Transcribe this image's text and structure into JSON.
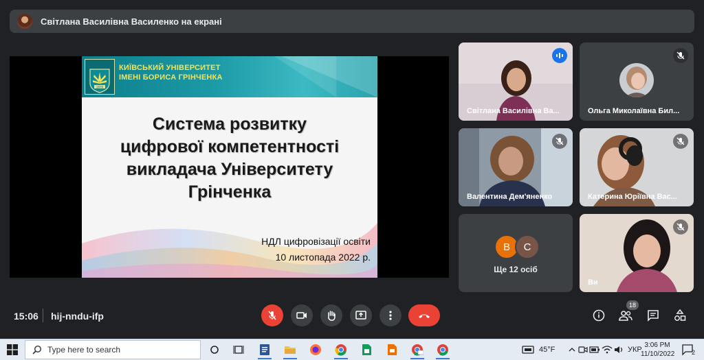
{
  "banner": {
    "presenter_text": "Світлана Василівна Василенко на екрані"
  },
  "slide": {
    "university_line1": "Київський університет",
    "university_line2": "імені Бориса Грінченка",
    "logo_year": "1876",
    "title_lines": [
      "Система розвитку",
      "цифрової компетентності",
      "викладача Університету",
      "Грінченка"
    ],
    "meta_line1": "НДЛ цифровізації освіти",
    "meta_line2": "10 листопада 2022 р."
  },
  "participants": [
    {
      "name": "Світлана Василівна Ва...",
      "state": "speaking"
    },
    {
      "name": "Ольга Миколаївна Бил...",
      "state": "muted"
    },
    {
      "name": "Валентина Дем'яненко",
      "state": "muted"
    },
    {
      "name": "Катерина Юріївна Вас...",
      "state": "muted"
    },
    {
      "name": "Ви",
      "state": "muted"
    }
  ],
  "more": {
    "avatar1": "В",
    "avatar2": "С",
    "label": "Ще 12 осіб",
    "avatar1_color": "#e8710a",
    "avatar2_color": "#795548"
  },
  "controls": {
    "time": "15:06",
    "meeting_code": "hij-nndu-ifp",
    "people_count": "18"
  },
  "taskbar": {
    "search_placeholder": "Type here to search",
    "temperature": "45°F",
    "language": "УКР",
    "time": "3:06 PM",
    "date": "11/10/2022",
    "notifications": "2"
  },
  "colors": {
    "accent": "#8ab4f8",
    "danger": "#ea4335",
    "surface": "#3c4043",
    "background": "#202124"
  }
}
